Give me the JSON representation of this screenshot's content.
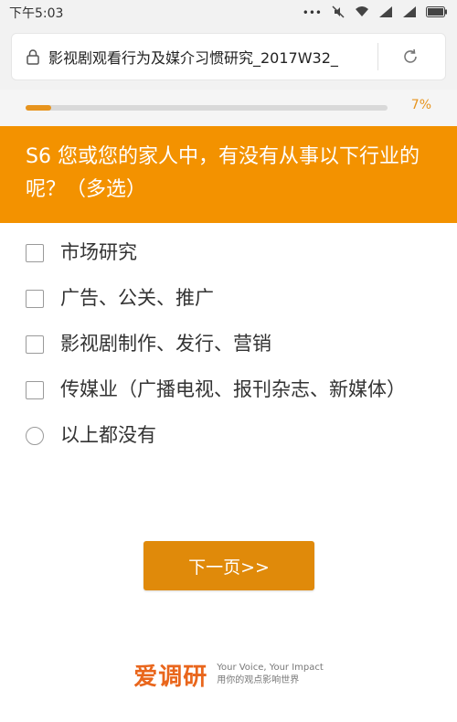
{
  "status_bar": {
    "time": "下午5:03",
    "icons": [
      "dots-icon",
      "mute-icon",
      "wifi-icon",
      "signal-icon",
      "signal-icon",
      "battery-icon"
    ]
  },
  "browser": {
    "url_text": "影视剧观看行为及媒介习惯研究_2017W32_"
  },
  "progress": {
    "percent_label": "7%",
    "fraction": 0.07
  },
  "question": {
    "title": "S6 您或您的家人中，有没有从事以下行业的呢？（多选）"
  },
  "options": [
    {
      "type": "checkbox",
      "label": "市场研究"
    },
    {
      "type": "checkbox",
      "label": "广告、公关、推广"
    },
    {
      "type": "checkbox",
      "label": "影视剧制作、发行、营销"
    },
    {
      "type": "checkbox",
      "label": "传媒业（广播电视、报刊杂志、新媒体）"
    },
    {
      "type": "radio",
      "label": "以上都没有"
    }
  ],
  "actions": {
    "next_label": "下一页>>"
  },
  "footer": {
    "brand": "爱调研",
    "tagline_en": "Your Voice, Your Impact",
    "tagline_cn": "用你的观点影响世界"
  },
  "colors": {
    "accent": "#f39200",
    "button": "#e08a0a",
    "brand": "#e9661c"
  }
}
